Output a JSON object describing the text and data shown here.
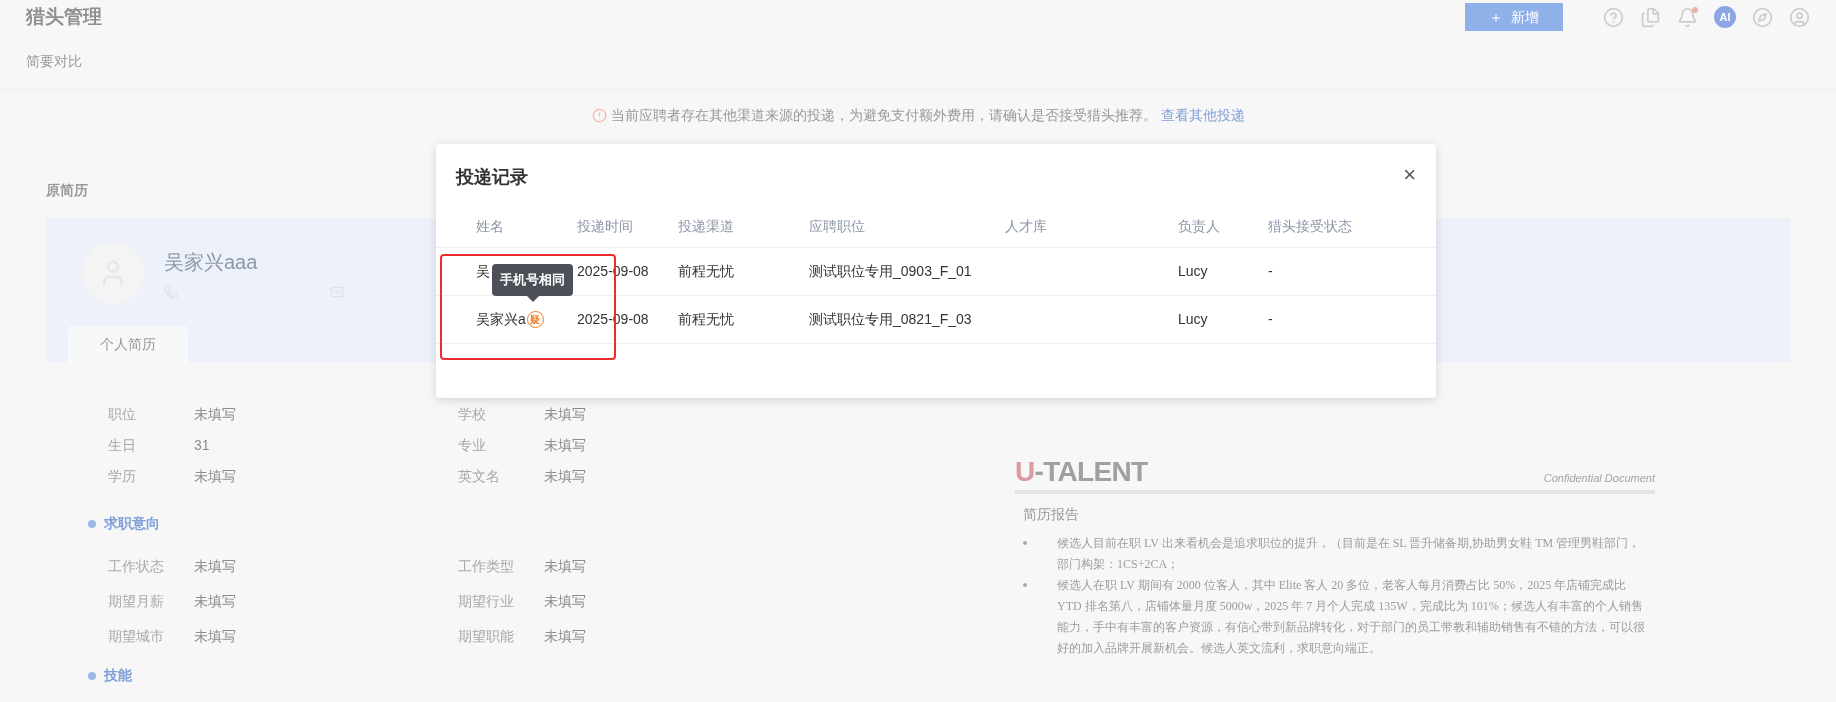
{
  "header": {
    "title": "猎头管理",
    "add_button": {
      "icon": "＋",
      "label": "新增"
    },
    "avatar_text": "AI",
    "notification_dot": true
  },
  "subnav": {
    "label": "简要对比"
  },
  "notice": {
    "text": "当前应聘者存在其他渠道来源的投递，为避免支付额外费用，请确认是否接受猎头推荐。",
    "link": "查看其他投递"
  },
  "resume": {
    "title": "原简历",
    "name": "吴家兴aaa",
    "tab": "个人简历",
    "basic_fields": [
      {
        "label": "职位",
        "value": "未填写"
      },
      {
        "label": "学校",
        "value": "未填写"
      },
      {
        "label": "生日",
        "value": "31"
      },
      {
        "label": "专业",
        "value": "未填写"
      },
      {
        "label": "学历",
        "value": "未填写"
      },
      {
        "label": "英文名",
        "value": "未填写"
      }
    ],
    "intent_title": "求职意向",
    "intent_fields": [
      {
        "label": "工作状态",
        "value": "未填写"
      },
      {
        "label": "工作类型",
        "value": "未填写"
      },
      {
        "label": "期望月薪",
        "value": "未填写"
      },
      {
        "label": "期望行业",
        "value": "未填写"
      },
      {
        "label": "期望城市",
        "value": "未填写"
      },
      {
        "label": "期望职能",
        "value": "未填写"
      }
    ],
    "skills_title": "技能"
  },
  "report": {
    "logo_prefix": "U",
    "logo_rest": "-TALENT",
    "confidential": "Confidential Document",
    "title": "简历报告",
    "bullets": [
      "候选人目前在职 LV 出来看机会是追求职位的提升，（目前是在 SL 晋升储备期,协助男女鞋 TM 管理男鞋部门，部门构架：1CS+2CA；",
      "候选人在职 LV 期间有 2000 位客人，其中 Elite 客人 20 多位，老客人每月消费占比 50%，2025 年店铺完成比 YTD 排名第八，店铺体量月度 5000w，2025 年 7 月个人完成 135W，完成比为 101%；候选人有丰富的个人销售能力，手中有丰富的客户资源，有信心带到新品牌转化，对于部门的员工带教和辅助销售有不错的方法，可以很好的加入品牌开展新机会。候选人英文流利，求职意向端正。"
    ]
  },
  "dialog": {
    "title": "投递记录",
    "close": "×",
    "columns": [
      "姓名",
      "投递时间",
      "投递渠道",
      "应聘职位",
      "人才库",
      "负责人",
      "猎头接受状态"
    ],
    "rows": [
      {
        "name": "吴",
        "suspect_badge": "",
        "date": "2025-09-08",
        "channel": "前程无忧",
        "position": "测试职位专用_0903_F_01",
        "owner": "Lucy",
        "status": "-"
      },
      {
        "name": "吴家兴a",
        "suspect_badge": "疑",
        "date": "2025-09-08",
        "channel": "前程无忧",
        "position": "测试职位专用_0821_F_03",
        "owner": "Lucy",
        "status": "-"
      }
    ],
    "tooltip": "手机号相同",
    "highlight": true
  }
}
